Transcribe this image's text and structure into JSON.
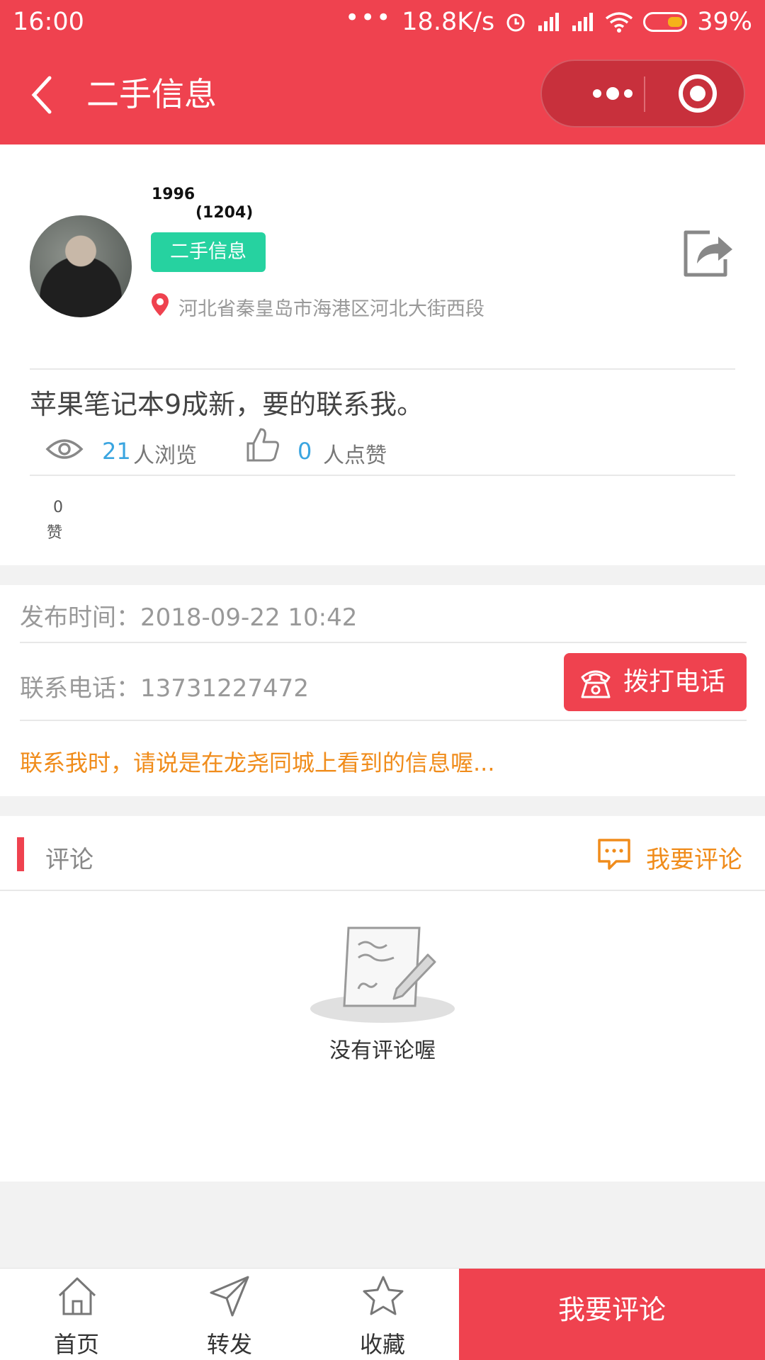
{
  "status_bar": {
    "time": "16:00",
    "speed": "18.8K/s",
    "battery": "39%"
  },
  "nav": {
    "title": "二手信息",
    "back_icon": "chevron-left-icon",
    "more_icon": "more-dots-icon",
    "close_icon": "target-circle-icon"
  },
  "post": {
    "user_name": "1996",
    "user_id": "(1204)",
    "category_badge": "二手信息",
    "location": "河北省秦皇岛市海港区河北大街西段",
    "content": "苹果笔记本9成新，要的联系我。",
    "views_count": "21",
    "views_label": "人浏览",
    "likes_count": "0",
    "likes_label": "人点赞",
    "zan_count": "0",
    "zan_label": "赞"
  },
  "info": {
    "publish_time": "发布时间：2018-09-22 10:42",
    "phone": "联系电话：13731227472",
    "call_button": "拨打电话",
    "tip": "联系我时，请说是在龙尧同城上看到的信息喔..."
  },
  "comments": {
    "title": "评论",
    "action": "我要评论",
    "empty_text": "没有评论喔"
  },
  "bottom_bar": {
    "tabs": [
      {
        "label": "首页",
        "icon": "home-icon"
      },
      {
        "label": "转发",
        "icon": "send-icon"
      },
      {
        "label": "收藏",
        "icon": "star-icon"
      }
    ],
    "comment_button": "我要评论"
  },
  "colors": {
    "brand_red": "#ef424f",
    "badge_green": "#26d2a0",
    "accent_orange": "#f08c1b",
    "link_blue": "#3aa5e0"
  }
}
